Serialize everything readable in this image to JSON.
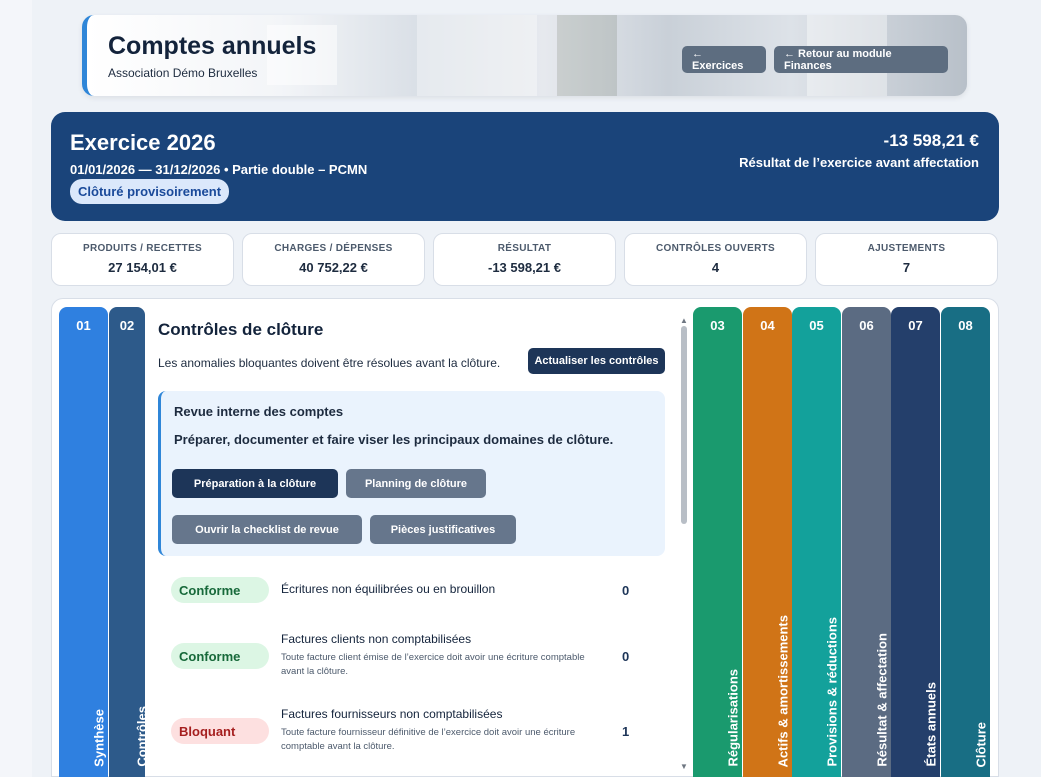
{
  "header": {
    "title": "Comptes annuels",
    "subtitle": "Association Démo Bruxelles",
    "btn_exercises": "← Exercices",
    "btn_back_finance": "← Retour au module Finances"
  },
  "exercise": {
    "title": "Exercice 2026",
    "meta": "01/01/2026 — 31/12/2026 • Partie double – PCMN",
    "status": "Clôturé provisoirement",
    "result_amount": "-13 598,21 €",
    "result_label": "Résultat de l’exercice avant affectation"
  },
  "kpis": [
    {
      "label": "PRODUITS / RECETTES",
      "value": "27 154,01 €"
    },
    {
      "label": "CHARGES / DÉPENSES",
      "value": "40 752,22 €"
    },
    {
      "label": "RÉSULTAT",
      "value": "-13 598,21 €"
    },
    {
      "label": "CONTRÔLES OUVERTS",
      "value": "4"
    },
    {
      "label": "AJUSTEMENTS",
      "value": "7"
    }
  ],
  "tabs": [
    {
      "num": "01",
      "label": "Synthèse",
      "color": "#2f80e0"
    },
    {
      "num": "02",
      "label": "Contrôles",
      "color": "#2d5a8a"
    },
    {
      "num": "03",
      "label": "Régularisations",
      "color": "#1a9a6e"
    },
    {
      "num": "04",
      "label": "Actifs & amortissements",
      "color": "#d07417"
    },
    {
      "num": "05",
      "label": "Provisions & réductions",
      "color": "#13a19b"
    },
    {
      "num": "06",
      "label": "Résultat & affectation",
      "color": "#5b6b82"
    },
    {
      "num": "07",
      "label": "États annuels",
      "color": "#243f6b"
    },
    {
      "num": "08",
      "label": "Clôture",
      "color": "#186e84"
    }
  ],
  "controls": {
    "title": "Contrôles de clôture",
    "description": "Les anomalies bloquantes doivent être résolues avant la clôture.",
    "refresh_button": "Actualiser les contrôles",
    "review": {
      "title": "Revue interne des comptes",
      "description": "Préparer, documenter et faire viser les principaux domaines de clôture.",
      "btn_prep": "Préparation à la clôture",
      "btn_planning": "Planning de clôture",
      "btn_checklist": "Ouvrir la checklist de revue",
      "btn_pieces": "Pièces justificatives"
    },
    "items": [
      {
        "status": "Conforme",
        "title": "Écritures non équilibrées ou en brouillon",
        "detail": "",
        "count": "0"
      },
      {
        "status": "Conforme",
        "title": "Factures clients non comptabilisées",
        "detail": "Toute facture client émise de l’exercice doit avoir une écriture comptable avant la clôture.",
        "count": "0"
      },
      {
        "status": "Bloquant",
        "title": "Factures fournisseurs non comptabilisées",
        "detail": "Toute facture fournisseur définitive de l’exercice doit avoir une écriture comptable avant la clôture.",
        "count": "1"
      }
    ]
  }
}
